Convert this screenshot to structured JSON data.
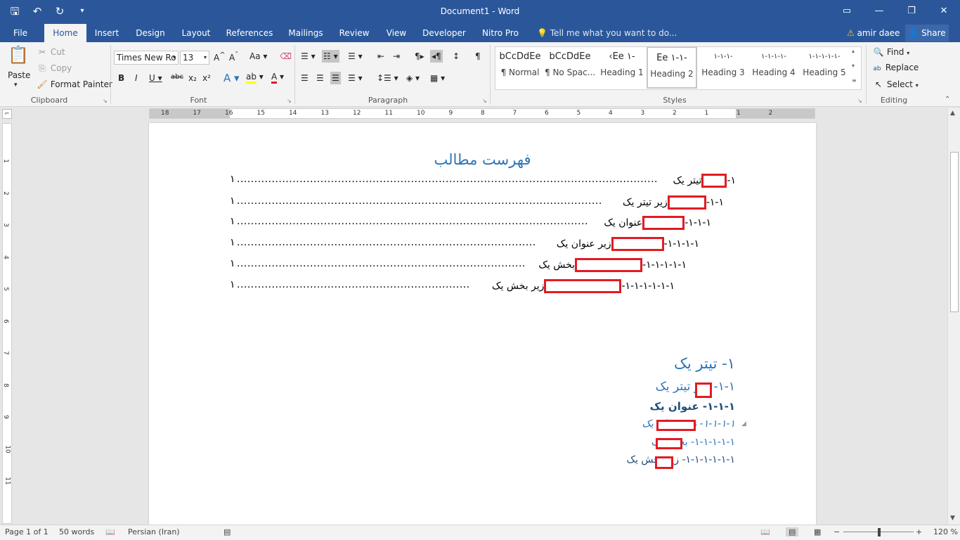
{
  "window": {
    "title": "Document1 - Word",
    "qat": [
      "save-icon",
      "undo-icon",
      "redo-icon",
      "customize-icon"
    ]
  },
  "tabs": [
    "File",
    "Home",
    "Insert",
    "Design",
    "Layout",
    "References",
    "Mailings",
    "Review",
    "View",
    "Developer",
    "Nitro Pro"
  ],
  "active_tab": "Home",
  "tell_me": "Tell me what you want to do...",
  "user": "amir daee",
  "share": "Share",
  "clipboard": {
    "paste": "Paste",
    "cut": "Cut",
    "copy": "Copy",
    "format_painter": "Format Painter",
    "label": "Clipboard"
  },
  "font": {
    "name": "Times New Ro",
    "size": "13",
    "label": "Font"
  },
  "paragraph": {
    "label": "Paragraph"
  },
  "styles": {
    "label": "Styles",
    "items": [
      {
        "preview": "bCcDdEe",
        "name": "¶ Normal"
      },
      {
        "preview": "bCcDdEe",
        "name": "¶ No Spac..."
      },
      {
        "preview": "‹Ee ١-",
        "name": "Heading 1"
      },
      {
        "preview": "Ee ١-١-",
        "name": "Heading 2"
      },
      {
        "preview": "١-١-١-",
        "name": "Heading 3"
      },
      {
        "preview": "١-١-١-١-",
        "name": "Heading 4"
      },
      {
        "preview": "١-١-١-١-١-",
        "name": "Heading 5"
      }
    ]
  },
  "editing": {
    "find": "Find",
    "replace": "Replace",
    "select": "Select",
    "label": "Editing"
  },
  "ruler_numbers": [
    "18",
    "17",
    "16",
    "15",
    "14",
    "13",
    "12",
    "11",
    "10",
    "9",
    "8",
    "7",
    "6",
    "5",
    "4",
    "3",
    "2",
    "1",
    "1",
    "2"
  ],
  "vruler_numbers": [
    "1",
    "2",
    "3",
    "4",
    "5",
    "6",
    "7",
    "8",
    "9",
    "10",
    "11"
  ],
  "document": {
    "toc_title": "فهرست مطالب",
    "toc": [
      {
        "number": "١-",
        "text": "تیتر یک",
        "page": "١"
      },
      {
        "number": "١-١-",
        "text": "زیر تیتر یک",
        "page": "١"
      },
      {
        "number": "١-١-١-",
        "text": "عنوان یک",
        "page": "١"
      },
      {
        "number": "١-١-١-١-",
        "text": "زیر عنوان یک",
        "page": "١"
      },
      {
        "number": "١-١-١-١-١-",
        "text": "بخش یک",
        "page": "١"
      },
      {
        "number": "١-١-١-١-١-١-",
        "text": "زیر بخش یک",
        "page": "١"
      }
    ],
    "headings": [
      {
        "text": "١-  تیتر یک"
      },
      {
        "text": "١-١-  زیر تیتر یک"
      },
      {
        "text": "١-١-١-  عنوان یک"
      },
      {
        "text": "١-١-١-١-  زیر عنوان یک"
      },
      {
        "text": "١-١-١-١-١-  بخش یک"
      },
      {
        "text": "١-١-١-١-١-١-  زیر بخش یک"
      }
    ]
  },
  "status": {
    "page": "Page 1 of 1",
    "words": "50 words",
    "language": "Persian (Iran)",
    "zoom": "120 %"
  },
  "colors": {
    "brand": "#2b579a",
    "heading": "#2e74b5",
    "redaction": "#e21b23"
  }
}
